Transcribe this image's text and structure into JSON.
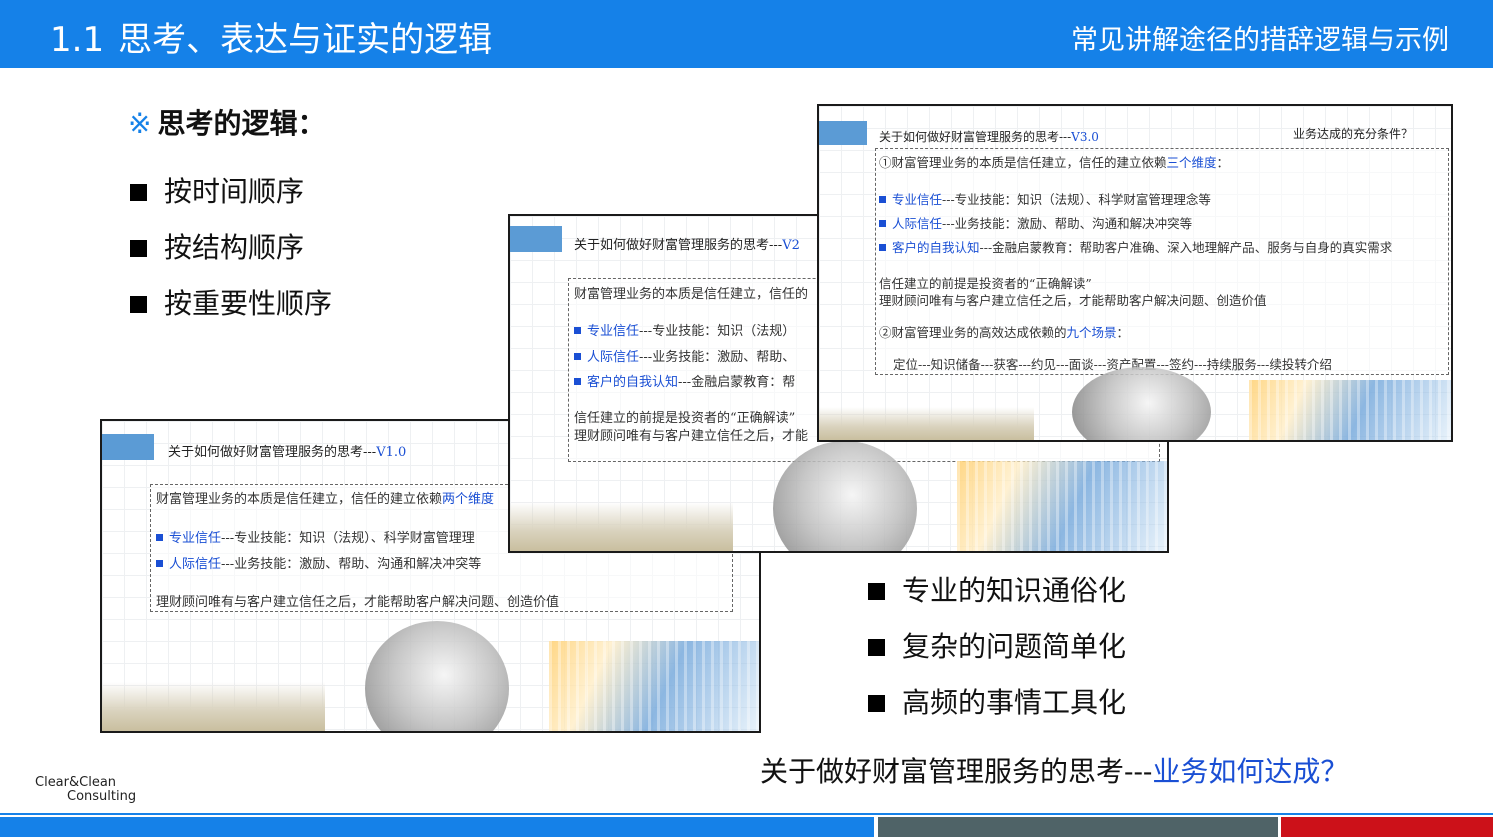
{
  "header": {
    "section_number": "1.1",
    "title": "思考、表达与证实的逻辑",
    "subtitle": "常见讲解途径的措辞逻辑与示例"
  },
  "thinking": {
    "mark": "※",
    "heading": "思考的逻辑：",
    "items": [
      "按时间顺序",
      "按结构顺序",
      "按重要性顺序"
    ]
  },
  "principles": {
    "items": [
      "专业的知识通俗化",
      "复杂的问题简单化",
      "高频的事情工具化"
    ]
  },
  "caption": {
    "prefix": "关于做好财富管理服务的思考---",
    "question": "业务如何达成？"
  },
  "slide_v1": {
    "title": "关于如何做好财富管理服务的思考---",
    "version": "V1.0",
    "intro": "财富管理业务的本质是信任建立，信任的建立依赖",
    "intro_blue": "两个维度",
    "b1_label": "专业信任",
    "b1_text": "---专业技能：知识（法规）、科学财富管理理",
    "b2_label": "人际信任",
    "b2_text": "---业务技能：激励、帮助、沟通和解决冲突等",
    "note": "理财顾问唯有与客户建立信任之后，才能帮助客户解决问题、创造价值"
  },
  "slide_v2": {
    "title": "关于如何做好财富管理服务的思考---",
    "version": "V2",
    "intro": "财富管理业务的本质是信任建立，信任的",
    "b1_label": "专业信任",
    "b1_text": "---专业技能：知识（法规）",
    "b2_label": "人际信任",
    "b2_text": "---业务技能：激励、帮助、",
    "b3_label": "客户的自我认知",
    "b3_text": "---金融启蒙教育：帮",
    "note1": "信任建立的前提是投资者的“正确解读”",
    "note2": "理财顾问唯有与客户建立信任之后，才能"
  },
  "slide_v3": {
    "title": "关于如何做好财富管理服务的思考---",
    "version": "V3.0",
    "corner": "业务达成的充分条件？",
    "intro": "①财富管理业务的本质是信任建立，信任的建立依赖",
    "intro_blue": "三个维度",
    "intro_end": "：",
    "b1_label": "专业信任",
    "b1_text": "---专业技能：知识（法规）、科学财富管理理念等",
    "b2_label": "人际信任",
    "b2_text": "---业务技能：激励、帮助、沟通和解决冲突等",
    "b3_label": "客户的自我认知",
    "b3_text": "---金融启蒙教育：帮助客户准确、深入地理解产品、服务与自身的真实需求",
    "note1": "信任建立的前提是投资者的“正确解读”",
    "note2": "理财顾问唯有与客户建立信任之后，才能帮助客户解决问题、创造价值",
    "scenario_intro": "②财富管理业务的高效达成依赖的",
    "scenario_blue": "九个场景",
    "scenario_end": "：",
    "scenarios": "定位---知识储备---获客---约见---面谈---资产配置---签约---持续服务---续投转介绍"
  },
  "footer": {
    "logo_line1": "Clear&Clean",
    "logo_line2": "Consulting"
  },
  "colors": {
    "brand_blue": "#1581e8",
    "accent_blue": "#1a4fd4",
    "footer_gray": "#4f6367",
    "footer_red": "#cc1119"
  }
}
